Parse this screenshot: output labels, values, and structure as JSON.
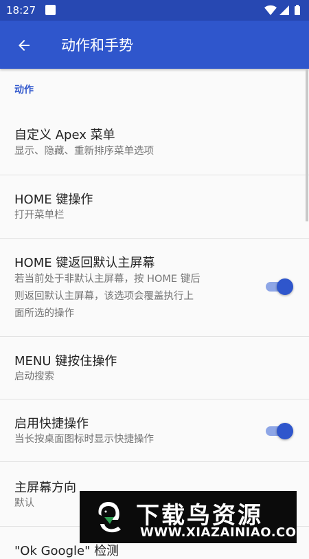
{
  "status_bar": {
    "time": "18:27",
    "icons": [
      "notification-square-icon",
      "wifi-icon",
      "signal-icon",
      "battery-icon"
    ]
  },
  "app_bar": {
    "back_icon": "arrow-back-icon",
    "title": "动作和手势"
  },
  "section": {
    "header": "动作"
  },
  "settings": [
    {
      "title": "自定义 Apex 菜单",
      "subtitle": "显示、隐藏、重新排序菜单选项"
    },
    {
      "title": "HOME 键操作",
      "subtitle": "打开菜单栏"
    },
    {
      "title": "HOME 键返回默认主屏幕",
      "subtitle_lines": [
        "若当前处于非默认主屏幕，按 HOME 键后",
        "则返回默认主屏幕，该选项会覆盖执行上",
        "面所选的操作"
      ],
      "toggle": true
    },
    {
      "title": "MENU 键按住操作",
      "subtitle": "启动搜索"
    },
    {
      "title": "启用快捷操作",
      "subtitle": "当长按桌面图标时显示快捷操作",
      "toggle": true
    },
    {
      "title": "主屏幕方向",
      "subtitle": "默认"
    },
    {
      "title": "\"Ok Google\" 检测"
    }
  ],
  "watermark": {
    "brand": "下载鸟资源",
    "url": "WWW.XIAZAINIAO.COM"
  },
  "colors": {
    "status_bar": "#2748b2",
    "app_bar": "#2f56cc",
    "accent": "#2f56cc",
    "switch_track": "#8ea6e6",
    "background": "#fafafa"
  }
}
